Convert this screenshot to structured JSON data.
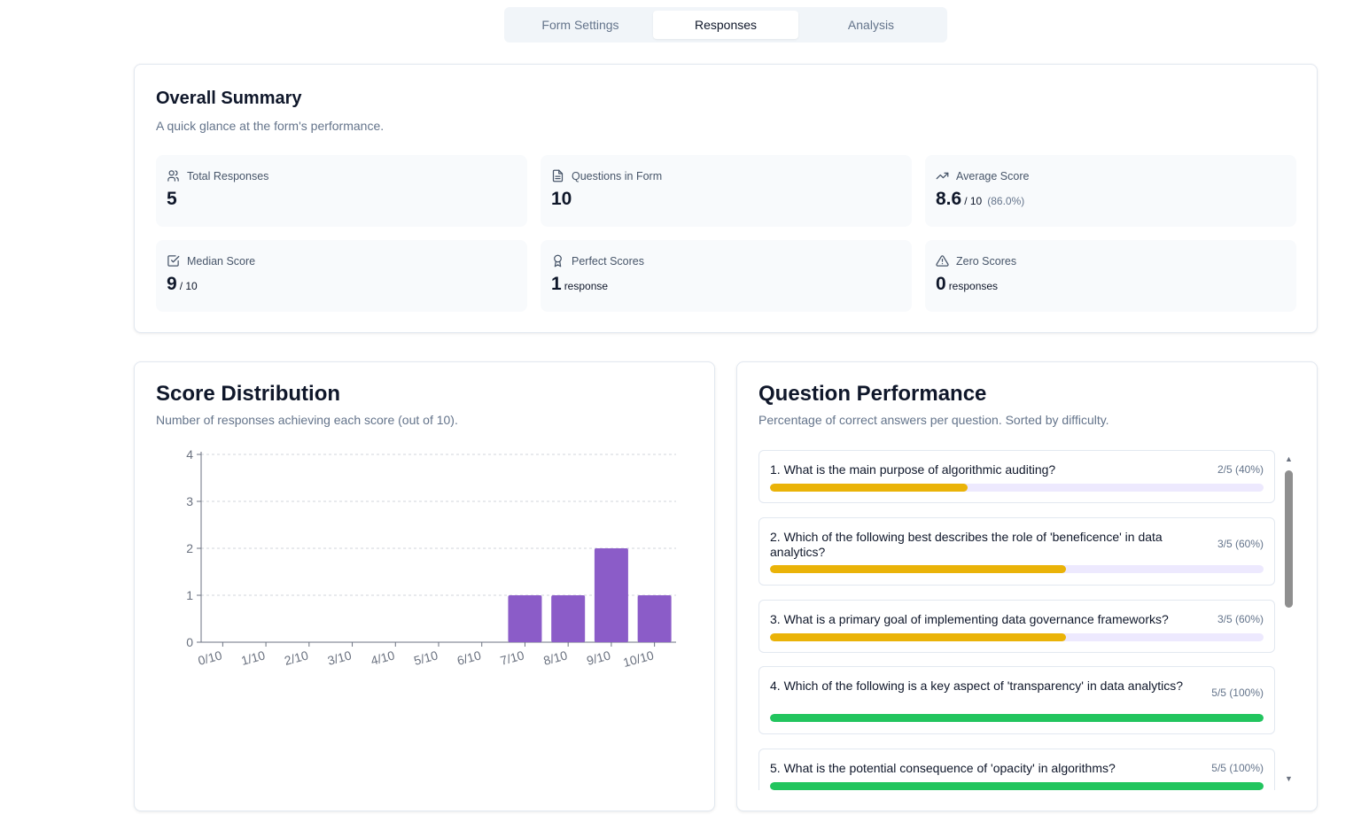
{
  "tabs": [
    {
      "label": "Form Settings"
    },
    {
      "label": "Responses"
    },
    {
      "label": "Analysis"
    }
  ],
  "active_tab": "Responses",
  "summary": {
    "title": "Overall Summary",
    "subtitle": "A quick glance at the form's performance.",
    "stats": {
      "total": {
        "label": "Total Responses",
        "value": "5",
        "icon": "users-icon"
      },
      "questions": {
        "label": "Questions in Form",
        "value": "10",
        "icon": "document-icon"
      },
      "average": {
        "label": "Average Score",
        "value": "8.6",
        "suffix": "/ 10",
        "extra": "(86.0%)",
        "icon": "trending-up-icon"
      },
      "median": {
        "label": "Median Score",
        "value": "9",
        "suffix": "/ 10",
        "icon": "check-square-icon"
      },
      "perfect": {
        "label": "Perfect Scores",
        "value": "1",
        "suffix": "response",
        "icon": "award-icon"
      },
      "zero": {
        "label": "Zero Scores",
        "value": "0",
        "suffix": "responses",
        "icon": "alert-triangle-icon"
      }
    }
  },
  "distribution": {
    "title": "Score Distribution",
    "subtitle": "Number of responses achieving each score (out of 10)."
  },
  "chart_data": {
    "type": "bar",
    "categories": [
      "0/10",
      "1/10",
      "2/10",
      "3/10",
      "4/10",
      "5/10",
      "6/10",
      "7/10",
      "8/10",
      "9/10",
      "10/10"
    ],
    "values": [
      0,
      0,
      0,
      0,
      0,
      0,
      0,
      1,
      1,
      2,
      1
    ],
    "yticks": [
      "0",
      "1",
      "2",
      "3",
      "4"
    ],
    "ylim": [
      0,
      4
    ],
    "grid": true,
    "bar_color": "#8b5cc8"
  },
  "performance": {
    "title": "Question Performance",
    "subtitle": "Percentage of correct answers per question. Sorted by difficulty.",
    "questions": [
      {
        "text": "1. What is the main purpose of algorithmic auditing?",
        "stat": "2/5 (40%)",
        "percent": 40,
        "color": "#eab308"
      },
      {
        "text": "2. Which of the following best describes the role of 'beneficence' in data analytics?",
        "stat": "3/5 (60%)",
        "percent": 60,
        "color": "#eab308"
      },
      {
        "text": "3. What is a primary goal of implementing data governance frameworks?",
        "stat": "3/5 (60%)",
        "percent": 60,
        "color": "#eab308"
      },
      {
        "text": "4. Which of the following is a key aspect of 'transparency' in data analytics?",
        "stat": "5/5 (100%)",
        "percent": 100,
        "color": "#22c55e"
      },
      {
        "text": "5. What is the potential consequence of 'opacity' in algorithms?",
        "stat": "5/5 (100%)",
        "percent": 100,
        "color": "#22c55e"
      }
    ]
  }
}
